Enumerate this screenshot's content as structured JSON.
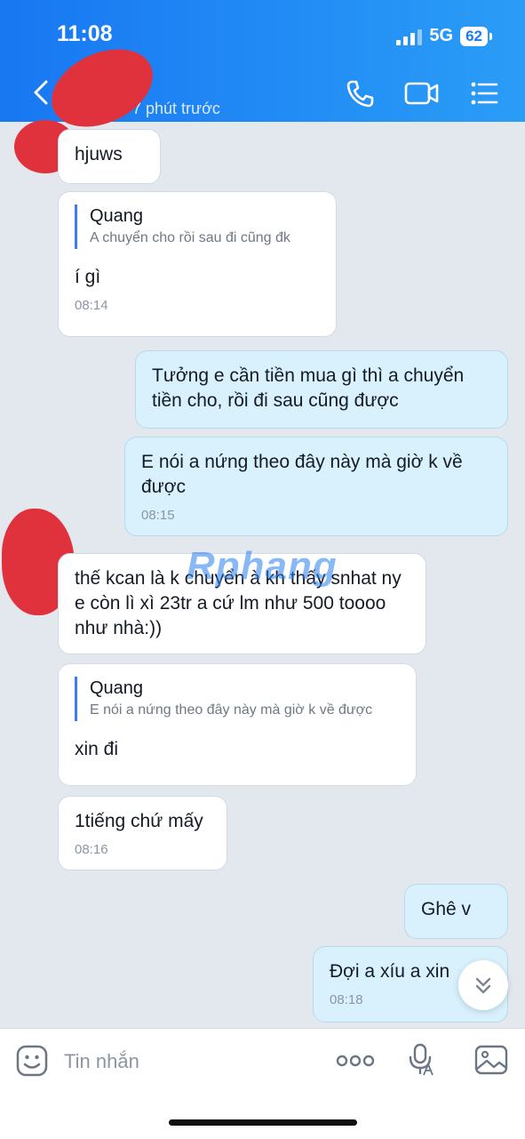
{
  "status_bar": {
    "time": "11:08",
    "network": "5G",
    "battery": "62"
  },
  "header": {
    "subtitle": "p 7 phút trước"
  },
  "messages": [
    {
      "text": "hjuws"
    },
    {
      "quote_name": "Quang",
      "quote_text": "A chuyển cho rồi sau đi cũng đk",
      "text": "í gì",
      "time": "08:14"
    },
    {
      "text": "Tưởng e cần tiền mua gì thì a chuyển tiền cho, rồi đi sau cũng được"
    },
    {
      "text": "E nói a nứng theo đây này mà giờ k về được",
      "time": "08:15"
    },
    {
      "text": "thế kcan là k chuyển à kh thấy snhat ny e còn lì xì 23tr a cứ lm như 500 toooo như nhà:))"
    },
    {
      "quote_name": "Quang",
      "quote_text": "E nói a nứng theo đây này mà giờ k về được",
      "text": "xin đi"
    },
    {
      "text": "1tiếng chứ mấy",
      "time": "08:16"
    },
    {
      "text": "Ghê v"
    },
    {
      "text": "Đợi a xíu a xin",
      "time": "08:18"
    }
  ],
  "watermark": "Rphang",
  "input": {
    "placeholder": "Tin nhắn"
  },
  "colors": {
    "header_start": "#1877f2",
    "header_end": "#2a9df7",
    "outgoing_bubble": "#d8f1fd",
    "incoming_bubble": "#ffffff",
    "background": "#e3e8ef"
  }
}
